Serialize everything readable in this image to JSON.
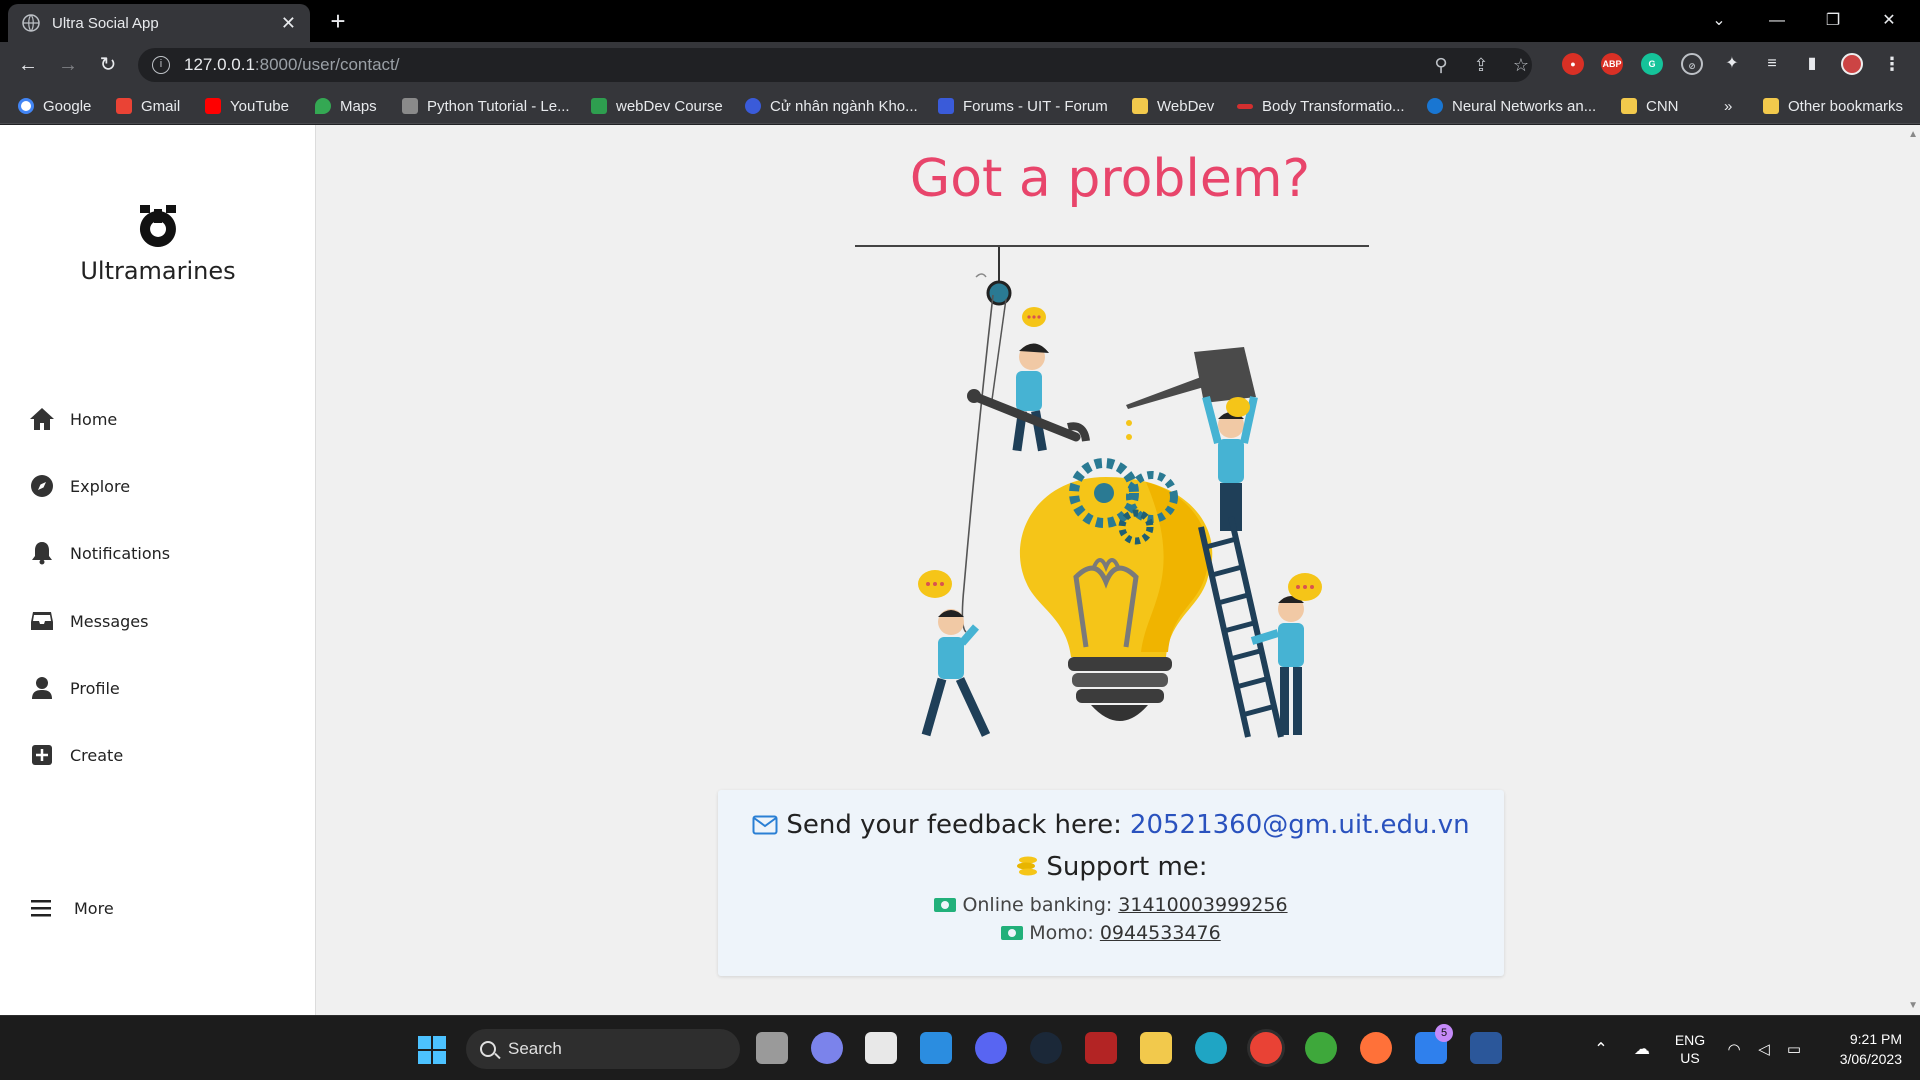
{
  "browser": {
    "tab_title": "Ultra Social App",
    "url_host": "127.0.0.1",
    "url_path": ":8000/user/contact/",
    "bookmarks": [
      {
        "label": "Google",
        "icon": "google-icon",
        "color": "#4285f4"
      },
      {
        "label": "Gmail",
        "icon": "gmail-icon",
        "color": "#ea4335"
      },
      {
        "label": "YouTube",
        "icon": "youtube-icon",
        "color": "#ff0000"
      },
      {
        "label": "Maps",
        "icon": "maps-icon",
        "color": "#34a853"
      },
      {
        "label": "Python Tutorial - Le...",
        "icon": "python-icon",
        "color": "#8a8a8a"
      },
      {
        "label": "webDev Course",
        "icon": "webdev-icon",
        "color": "#2e9e4f"
      },
      {
        "label": "Cử nhân ngành Kho...",
        "icon": "uit-icon",
        "color": "#3a5bd9"
      },
      {
        "label": "Forums - UIT - Forum",
        "icon": "forum-icon",
        "color": "#3a5bd9"
      },
      {
        "label": "WebDev",
        "icon": "folder-icon",
        "color": "#f2c94c"
      },
      {
        "label": "Body Transformatio...",
        "icon": "body-icon",
        "color": "#d32f2f"
      },
      {
        "label": "Neural Networks an...",
        "icon": "neural-icon",
        "color": "#1976d2"
      },
      {
        "label": "CNN",
        "icon": "folder-icon",
        "color": "#f2c94c"
      }
    ],
    "overflow": "»",
    "other_bookmarks": "Other bookmarks"
  },
  "sidebar": {
    "brand": "Ultramarines",
    "items": [
      {
        "label": "Home",
        "icon": "home-icon"
      },
      {
        "label": "Explore",
        "icon": "compass-icon"
      },
      {
        "label": "Notifications",
        "icon": "bell-icon"
      },
      {
        "label": "Messages",
        "icon": "inbox-icon"
      },
      {
        "label": "Profile",
        "icon": "person-icon"
      },
      {
        "label": "Create",
        "icon": "plus-square-icon"
      }
    ],
    "more": "More"
  },
  "main": {
    "headline": "Got a problem?",
    "feedback_label": "Send your feedback here:",
    "feedback_email": "20521360@gm.uit.edu.vn",
    "support_label": "Support me:",
    "banking_label": "Online banking:",
    "banking_number": "31410003999256",
    "momo_label": "Momo:",
    "momo_number": "0944533476"
  },
  "taskbar": {
    "search": "Search",
    "mail_badge": "5",
    "lang_top": "ENG",
    "lang_bottom": "US",
    "time": "9:21 PM",
    "date": "3/06/2023"
  },
  "colors": {
    "headline": "#e8456b",
    "email_link": "#2a52be",
    "card_bg": "#eef4fa"
  }
}
